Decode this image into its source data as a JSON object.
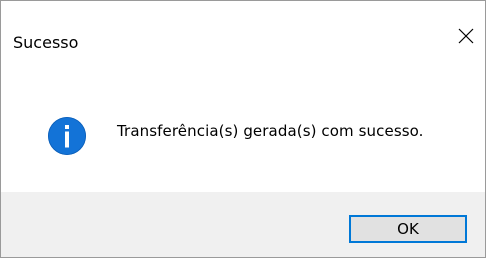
{
  "dialog": {
    "title": "Sucesso",
    "message": "Transferência(s) gerada(s) com sucesso.",
    "ok_label": "OK",
    "icon": "info-icon",
    "close_icon": "close-icon"
  },
  "colors": {
    "info_blue": "#1373d7",
    "button_border": "#0078d7",
    "footer_bg": "#f0f0f0"
  }
}
